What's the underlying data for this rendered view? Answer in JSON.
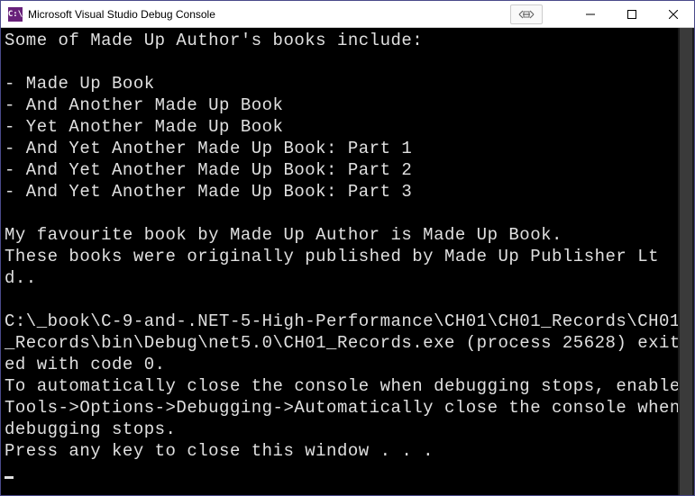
{
  "titlebar": {
    "icon_text": "C:\\",
    "title": "Microsoft Visual Studio Debug Console"
  },
  "console": {
    "intro": "Some of Made Up Author's books include:",
    "books": [
      "- Made Up Book",
      "- And Another Made Up Book",
      "- Yet Another Made Up Book",
      "- And Yet Another Made Up Book: Part 1",
      "- And Yet Another Made Up Book: Part 2",
      "- And Yet Another Made Up Book: Part 3"
    ],
    "favourite": "My favourite book by Made Up Author is Made Up Book.",
    "published": "These books were originally published by Made Up Publisher Ltd..",
    "exit_path": "C:\\_book\\C-9-and-.NET-5-High-Performance\\CH01\\CH01_Records\\CH01_Records\\bin\\Debug\\net5.0\\CH01_Records.exe (process 25628) exited with code 0.",
    "auto_close": "To automatically close the console when debugging stops, enable Tools->Options->Debugging->Automatically close the console when debugging stops.",
    "press_key": "Press any key to close this window . . ."
  }
}
